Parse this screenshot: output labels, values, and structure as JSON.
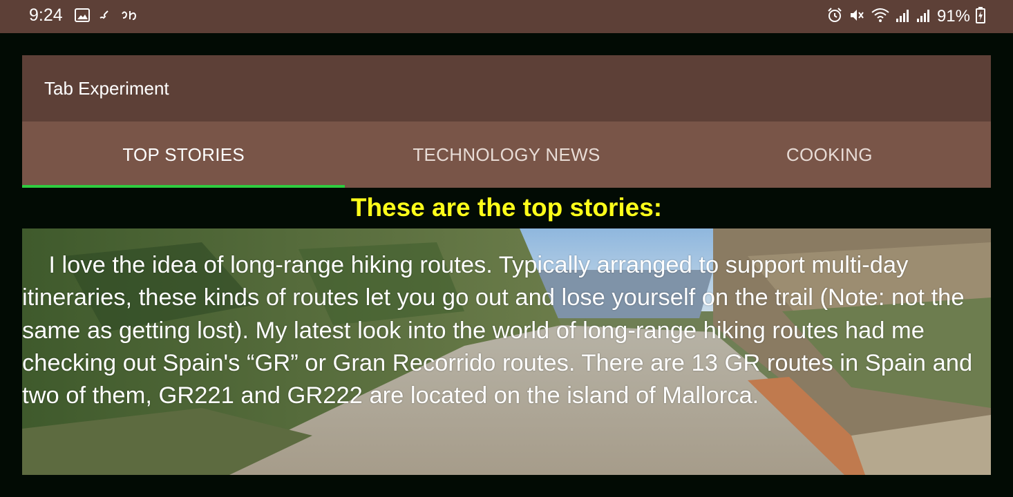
{
  "status_bar": {
    "time": "9:24",
    "left_icons": [
      "image-icon",
      "call-icon",
      "app-icon"
    ],
    "right_icons": [
      "alarm-icon",
      "mute-icon",
      "wifi-icon",
      "signal-icon",
      "signal-icon",
      "battery-charging-icon"
    ],
    "battery": "91%"
  },
  "toolbar": {
    "title": "Tab Experiment"
  },
  "tabs": [
    {
      "label": "TOP STORIES",
      "active": true
    },
    {
      "label": "TECHNOLOGY NEWS",
      "active": false
    },
    {
      "label": "COOKING",
      "active": false
    }
  ],
  "content": {
    "heading": "These are the top stories:",
    "story": "    I love the idea of long-range hiking routes. Typically arranged to support multi-day itineraries, these kinds of routes let you go out and lose yourself on the trail (Note: not the same as getting lost). My latest look into the world of long-range hiking routes had me checking out Spain's “GR” or Gran Recorrido routes. There are 13 GR routes in Spain and two of them, GR221 and GR222 are located on the island of Mallorca."
  },
  "colors": {
    "status_bar": "#5d4037",
    "toolbar": "#5d4037",
    "tab_bar": "#795548",
    "tab_indicator": "#2ecc40",
    "heading": "#ffff1a",
    "background": "#020b04"
  }
}
